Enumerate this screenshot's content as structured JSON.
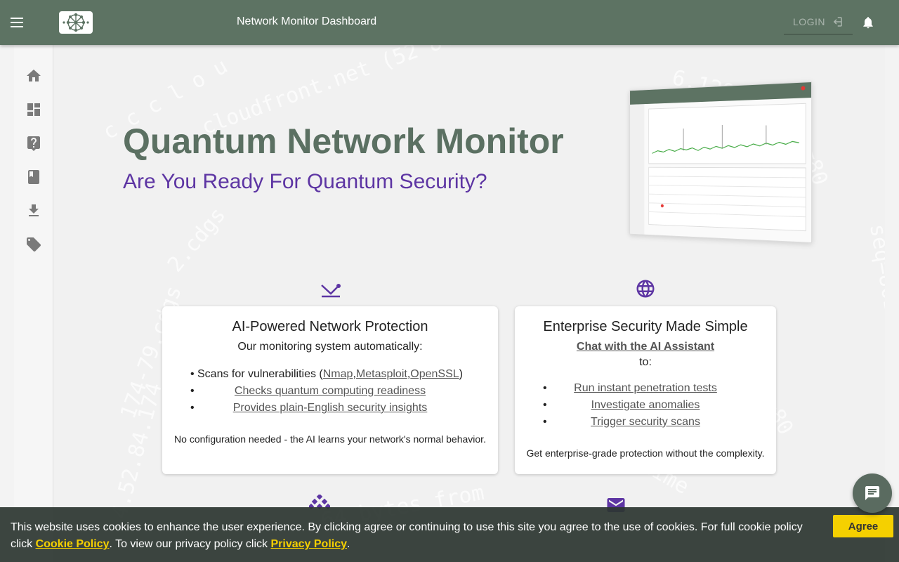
{
  "appbar": {
    "title": "Network Monitor Dashboard",
    "login_label": "LOGIN",
    "accent_color": "#5d7363"
  },
  "sidenav": {
    "items": [
      {
        "name": "home-icon"
      },
      {
        "name": "dashboard-icon"
      },
      {
        "name": "help-icon"
      },
      {
        "name": "book-icon"
      },
      {
        "name": "download-icon"
      },
      {
        "name": "tag-icon"
      }
    ]
  },
  "hero": {
    "title": "Quantum Network Monitor",
    "subtitle": "Are You Ready For Quantum Security?",
    "title_color": "#5b7062",
    "subtitle_color": "#5d35a3"
  },
  "card1": {
    "icon": "ai-download-icon",
    "title": "AI-Powered Network Protection",
    "lead": "Our monitoring system automatically:",
    "bullet1_prefix": "Scans for vulnerabilities (",
    "bullet1_link1": "Nmap",
    "bullet1_sep1": ",",
    "bullet1_link2": "Metasploit",
    "bullet1_sep2": ",",
    "bullet1_link3": "OpenSSL",
    "bullet1_suffix": ")",
    "bullet2": "Checks quantum computing readiness",
    "bullet3": "Provides plain-English security insights",
    "footer": "No configuration needed - the AI learns your network's normal behavior."
  },
  "card2": {
    "icon": "globe-icon",
    "title": "Enterprise Security Made Simple",
    "chat_link": "Chat with the AI Assistant",
    "to": "to:",
    "bullets": [
      "Run instant penetration tests",
      "Investigate anomalies",
      "Trigger security scans"
    ],
    "footer": "Get enterprise-grade protection without the complexity."
  },
  "cookie": {
    "text1": "This website uses cookies to enhance the user experience. By clicking agree or continuing to use this site you agree to the use of cookies. For full cookie policy click ",
    "cookie_link": "Cookie Policy",
    "text2": ". To view our privacy policy click ",
    "privacy_link": "Privacy Policy",
    "text3": ".",
    "agree_label": "Agree",
    "agree_color": "#f5d000"
  }
}
